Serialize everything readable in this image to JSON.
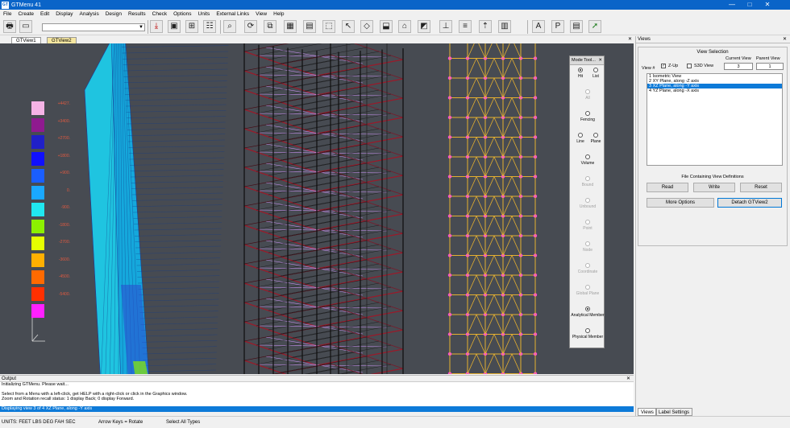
{
  "window": {
    "title": "GTMenu 41",
    "app_icon": "GT",
    "controls": {
      "minimize": "—",
      "maximize": "□",
      "close": "✕"
    }
  },
  "menu": [
    "File",
    "Create",
    "Edit",
    "Display",
    "Analysis",
    "Design",
    "Results",
    "Check",
    "Options",
    "Units",
    "External Links",
    "View",
    "Help"
  ],
  "toolbar": {
    "buttons": [
      "printer-icon",
      "download-icon",
      "window-icon",
      "frame-icon",
      "ladder-icon",
      "zoom-icon",
      "rotate-icon",
      "copy-icon",
      "mesh-icon",
      "grid-icon",
      "box3d-icon",
      "cursor-icon",
      "plane-icon",
      "stack-icon",
      "tower-icon",
      "fill-icon",
      "text-label-icon",
      "load-icon",
      "arrow-icon",
      "text-a-icon",
      "text-p-icon",
      "table-icon",
      "pointer-icon"
    ],
    "text_a": "A",
    "text_p": "P"
  },
  "tabs": [
    {
      "label": "GTView1",
      "active": true
    },
    {
      "label": "GTView2",
      "active": false
    }
  ],
  "legend": {
    "labels": [
      "+4427.",
      "+3400.",
      "+2700.",
      "+1800.",
      "+900.",
      "0.",
      "-900.",
      "-1800.",
      "-2700.",
      "-3600.",
      "-4500.",
      "-5400."
    ],
    "colors": [
      "#f5b3e6",
      "#8f1a8f",
      "#2020c8",
      "#1010ff",
      "#1a5eff",
      "#1aa8ff",
      "#20e8f0",
      "#8cf000",
      "#e6ff00",
      "#ffb000",
      "#ff6a00",
      "#ff3000",
      "#ff20ff"
    ]
  },
  "mode_tool": {
    "title": "Mode Tool...",
    "hit": "Hit",
    "list": "List",
    "all": "All",
    "fencing": "Fencing",
    "line": "Line",
    "plane": "Plane",
    "volume": "Volume",
    "bound": "Bound",
    "unbound": "Unbound",
    "point": "Point",
    "node": "Node",
    "coordinate": "Coordinate",
    "global_plane": "Global Plane",
    "analytical_member": "Analytical Member",
    "physical_member": "Physical Member"
  },
  "output": {
    "title": "Output",
    "lines": [
      "Initializing GTMenu.  Please wait...",
      "",
      "Select from a Menu with a left-click, get HELP with a right-click or click in the Graphics window.",
      "Zoom and Rotation recall status:     1 display Back;     0 display Forward."
    ],
    "selected": "Displaying view 3 of 4    XZ Plane, along -Y axis"
  },
  "status": {
    "units": "UNITS:  FEET  LBS  DEG  FAH  SEC",
    "hint": "Arrow Keys = Rotate",
    "select": "Select All Types"
  },
  "views": {
    "title": "Views",
    "group_title": "View Selection",
    "view_num_label": "View #",
    "zup": "Z-Up",
    "s3d": "S3D View",
    "current_label": "Current View",
    "current_value": "3",
    "parent_label": "Parent View",
    "parent_value": "1",
    "list": [
      "1  Isometric View",
      "2  XY Plane, along -Z axis",
      "3  XZ Plane, along -Y axis",
      "4  YZ Plane, along -X axis"
    ],
    "selected_index": 2,
    "file_group": "File Containing View Definitions",
    "read": "Read",
    "write": "Write",
    "reset": "Reset",
    "more": "More Options",
    "detach": "Detach GTView2",
    "tab_views": "Views",
    "tab_labels": "Label Settings"
  }
}
